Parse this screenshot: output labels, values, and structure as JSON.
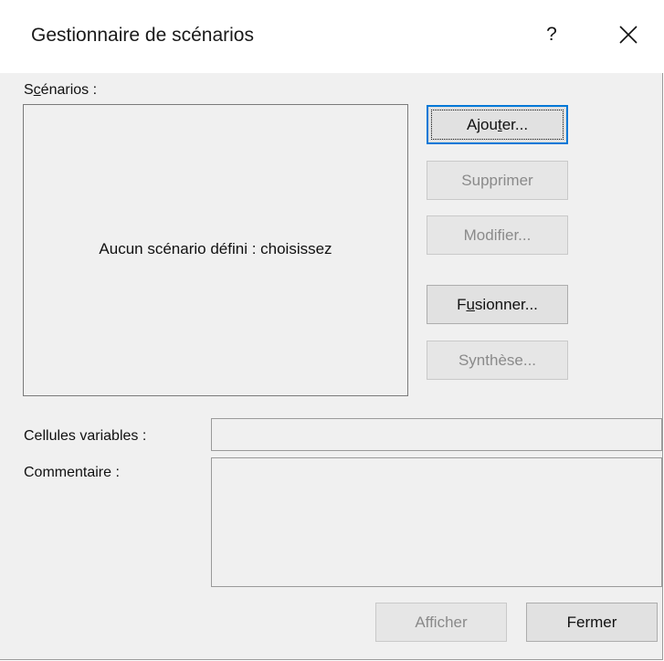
{
  "window": {
    "title": "Gestionnaire de scénarios",
    "help_label": "?"
  },
  "scenarios": {
    "label_pre": "S",
    "label_u": "c",
    "label_post": "énarios :",
    "empty_message": "Aucun scénario défini : choisissez"
  },
  "buttons": {
    "ajouter": {
      "pre": "Ajou",
      "u": "t",
      "post": "er..."
    },
    "supprimer": "Supprimer",
    "modifier": "Modifier...",
    "fusionner": {
      "pre": "F",
      "u": "u",
      "post": "sionner..."
    },
    "synthese": "Synthèse...",
    "afficher": "Afficher",
    "fermer": "Fermer"
  },
  "fields": {
    "cells_label": "Cellules variables :",
    "cells_value": "",
    "comment_label": "Commentaire :",
    "comment_value": ""
  },
  "colors": {
    "dialog_bg": "#f0f0f0",
    "accent": "#0078d7",
    "disabled_text": "#8a8a8a"
  }
}
